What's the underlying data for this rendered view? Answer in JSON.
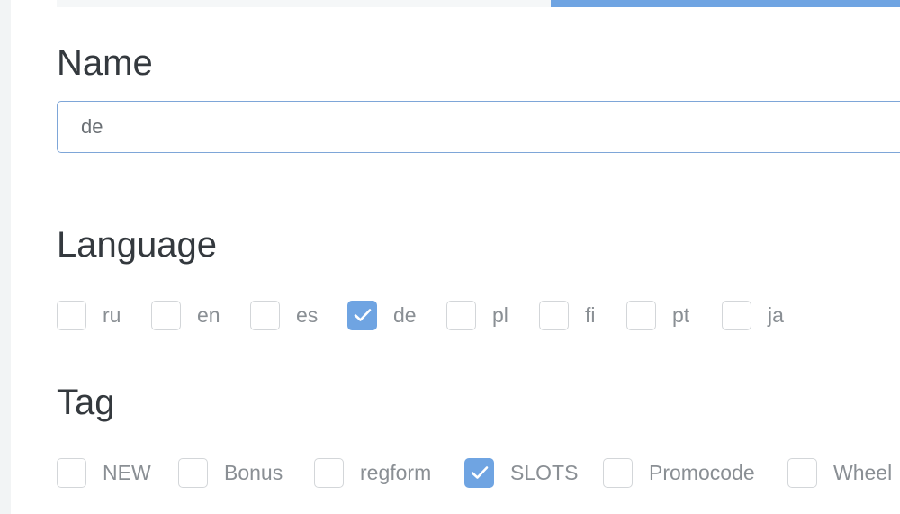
{
  "name_section": {
    "heading": "Name",
    "input_value": "de"
  },
  "language_section": {
    "heading": "Language",
    "options": [
      {
        "label": "ru",
        "checked": false
      },
      {
        "label": "en",
        "checked": false
      },
      {
        "label": "es",
        "checked": false
      },
      {
        "label": "de",
        "checked": true
      },
      {
        "label": "pl",
        "checked": false
      },
      {
        "label": "fi",
        "checked": false
      },
      {
        "label": "pt",
        "checked": false
      },
      {
        "label": "ja",
        "checked": false
      }
    ]
  },
  "tag_section": {
    "heading": "Tag",
    "options": [
      {
        "label": "NEW",
        "checked": false
      },
      {
        "label": "Bonus",
        "checked": false
      },
      {
        "label": "regform",
        "checked": false
      },
      {
        "label": "SLOTS",
        "checked": true
      },
      {
        "label": "Promocode",
        "checked": false
      },
      {
        "label": "Wheel",
        "checked": false
      }
    ]
  },
  "colors": {
    "accent": "#6fa4e2",
    "heading": "#34393e",
    "label": "#8a8f94",
    "checkbox_border": "#d3d6d9"
  },
  "icons": {
    "checked_mark": "checkmark-icon"
  }
}
